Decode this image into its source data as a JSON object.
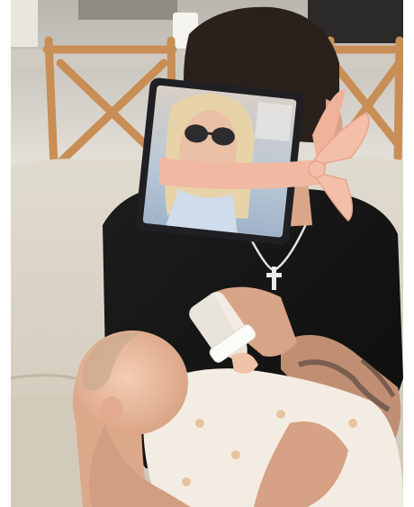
{
  "photo": {
    "kind": "photograph",
    "colors": {
      "sofa": "#d9d3c5",
      "shirt": "#141414",
      "tablet_frame": "#1f1f24",
      "headband": "#f2b9a2",
      "skin": "#e8b494",
      "baby_outfit": "#f3ece2",
      "wooden_chair": "#c98e55"
    }
  }
}
